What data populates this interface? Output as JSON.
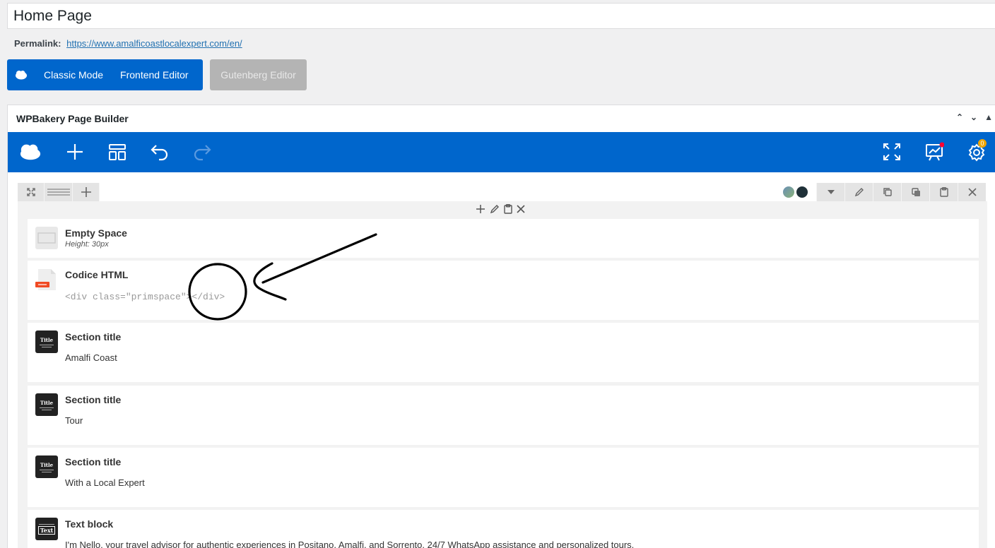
{
  "post": {
    "title": "Home Page",
    "permalink_label": "Permalink:",
    "permalink_url": "https://www.amalficoastlocalexpert.com/en/"
  },
  "modes": {
    "classic": "Classic Mode",
    "frontend": "Frontend Editor",
    "gutenberg": "Gutenberg Editor"
  },
  "builder": {
    "title": "WPBakery Page Builder",
    "toolbar_icons": [
      "wpbakery-logo-icon",
      "add-element-icon",
      "templates-icon",
      "undo-icon",
      "redo-icon",
      "fullscreen-icon",
      "seo-icon",
      "settings-icon"
    ],
    "settings_badge": "0",
    "brand_color": "#0066cc"
  },
  "elements": [
    {
      "title": "Empty Space",
      "subtitle": "Height: 30px"
    },
    {
      "title": "Codice HTML",
      "code": "<div class=\"primspace\"></div>"
    },
    {
      "title": "Section title",
      "text": "Amalfi Coast",
      "icon_label": "Title"
    },
    {
      "title": "Section title",
      "text": "Tour",
      "icon_label": "Title"
    },
    {
      "title": "Section title",
      "text": "With a Local Expert",
      "icon_label": "Title"
    },
    {
      "title": "Text block",
      "text": "I'm Nello, your travel advisor for authentic experiences in Positano, Amalfi, and Sorrento. 24/7 WhatsApp assistance and personalized tours.",
      "icon_label": "Text"
    }
  ]
}
